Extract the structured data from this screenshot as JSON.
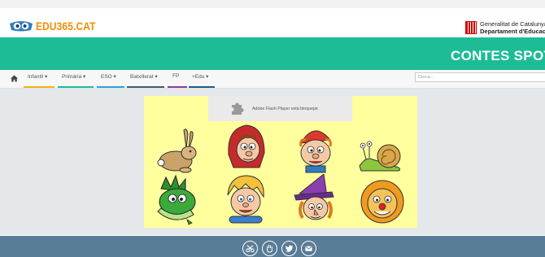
{
  "header": {
    "logo_text": "EDU365.CAT",
    "gencat_line1": "Generalitat de Catalunya",
    "gencat_line2": "Departament d'Educació"
  },
  "banner": {
    "title": "CONTES SPOT"
  },
  "nav": {
    "items": [
      {
        "label": "Infantil ▾",
        "color": "#f3b21b"
      },
      {
        "label": "Primària ▾",
        "color": "#1fbc9c"
      },
      {
        "label": "ESO ▾",
        "color": "#2aa3d9"
      },
      {
        "label": "Batxillerat ▾",
        "color": "#3f5e75"
      },
      {
        "label": "FP",
        "color": "#8e3aa3"
      },
      {
        "label": "+Edu ▾",
        "color": "#1e5d8c"
      }
    ],
    "search_placeholder": "Cerca..."
  },
  "flash": {
    "message": "Adobe Flash Player està bloquejat"
  },
  "characters": [
    "rabbit",
    "red-riding-hood",
    "gnome-boy",
    "snail",
    "dragon",
    "blond-boy",
    "witch",
    "lion"
  ],
  "footer": {
    "icons": [
      "scissors-icon",
      "hand-icon",
      "twitter-icon",
      "mail-icon"
    ]
  },
  "colors": {
    "brand_orange": "#f28c00",
    "banner_green": "#1dbc96",
    "footer_blue": "#5a7d97",
    "stage_yellow": "#ffff9e"
  }
}
